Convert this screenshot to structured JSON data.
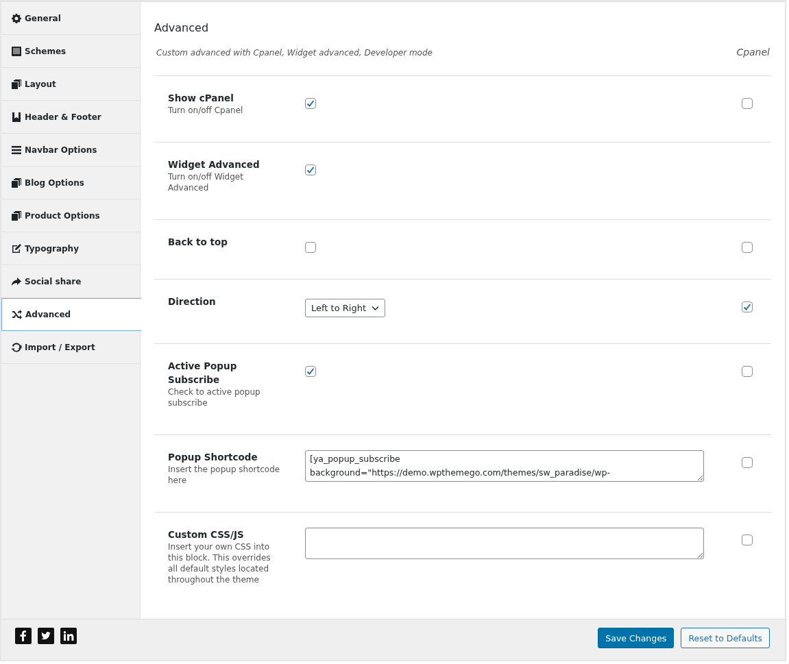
{
  "sidebar": {
    "items": [
      {
        "label": "General",
        "selected": false
      },
      {
        "label": "Schemes",
        "selected": false
      },
      {
        "label": "Layout",
        "selected": false
      },
      {
        "label": "Header & Footer",
        "selected": false
      },
      {
        "label": "Navbar Options",
        "selected": false
      },
      {
        "label": "Blog Options",
        "selected": false
      },
      {
        "label": "Product Options",
        "selected": false
      },
      {
        "label": "Typography",
        "selected": false
      },
      {
        "label": "Social share",
        "selected": false
      },
      {
        "label": "Advanced",
        "selected": true
      },
      {
        "label": "Import / Export",
        "selected": false
      }
    ]
  },
  "section": {
    "title": "Advanced",
    "subtitle": "Custom advanced with Cpanel, Widget advanced, Developer mode",
    "cpanel_heading": "Cpanel"
  },
  "options": [
    {
      "label": "Show cPanel",
      "description": "Turn on/off Cpanel",
      "kind": "checkbox",
      "checked": true,
      "cpanel": {
        "checked": false
      }
    },
    {
      "label": "Widget Advanced",
      "description": "Turn on/off Widget Advanced",
      "kind": "checkbox",
      "checked": true
    },
    {
      "label": "Back to top",
      "kind": "checkbox",
      "checked": false,
      "cpanel": {
        "checked": false
      }
    },
    {
      "label": "Direction",
      "kind": "select",
      "value": "Left to Right",
      "cpanel": {
        "checked": true
      }
    },
    {
      "label": "Active Popup Subscribe",
      "description": "Check to active popup subscribe",
      "kind": "checkbox",
      "checked": true,
      "cpanel": {
        "checked": false
      }
    },
    {
      "label": "Popup Shortcode",
      "description": "Insert the popup shortcode here",
      "kind": "textarea",
      "value": "[ya_popup_subscribe\nbackground=\"https://demo.wpthemego.com/themes/sw_paradise/wp-",
      "cpanel": {
        "checked": false
      }
    },
    {
      "label": "Custom CSS/JS",
      "description": "Insert your own CSS into this block. This overrides all default styles located throughout the theme",
      "kind": "textarea",
      "cpanel": {
        "checked": false
      }
    }
  ],
  "footer": {
    "buttons": [
      {
        "label": "Save Changes",
        "kind": "primary"
      },
      {
        "label": "Reset to Defaults",
        "kind": "secondary"
      }
    ]
  }
}
